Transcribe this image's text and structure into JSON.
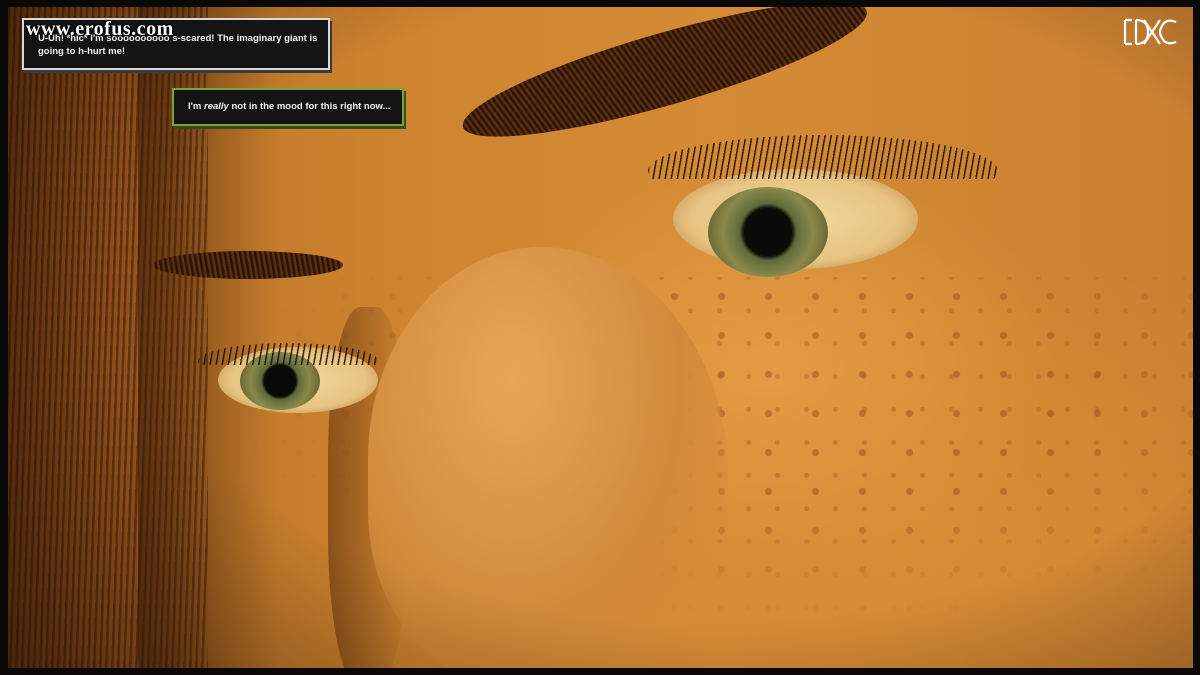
{
  "watermark": {
    "text": "www.erofus.com"
  },
  "dialogs": [
    {
      "text": "U-Uh! *hic* I'm soooooooooo s-scared! The imaginary giant is going to h-hurt me!"
    },
    {
      "before": "I'm ",
      "emphasis": "really",
      "after": " not in the mood for this right now..."
    }
  ],
  "logo": {
    "text": "IXC",
    "icon": "studio-logo-icon",
    "color": "#ffffff"
  },
  "colors": {
    "skin": "#d48b34",
    "hair": "#6b3a12",
    "dialog_bg": "#141414",
    "dialog_border_1": "#d9d9d9",
    "dialog_border_2": "#7aa33a",
    "frame": "#0b0908"
  }
}
